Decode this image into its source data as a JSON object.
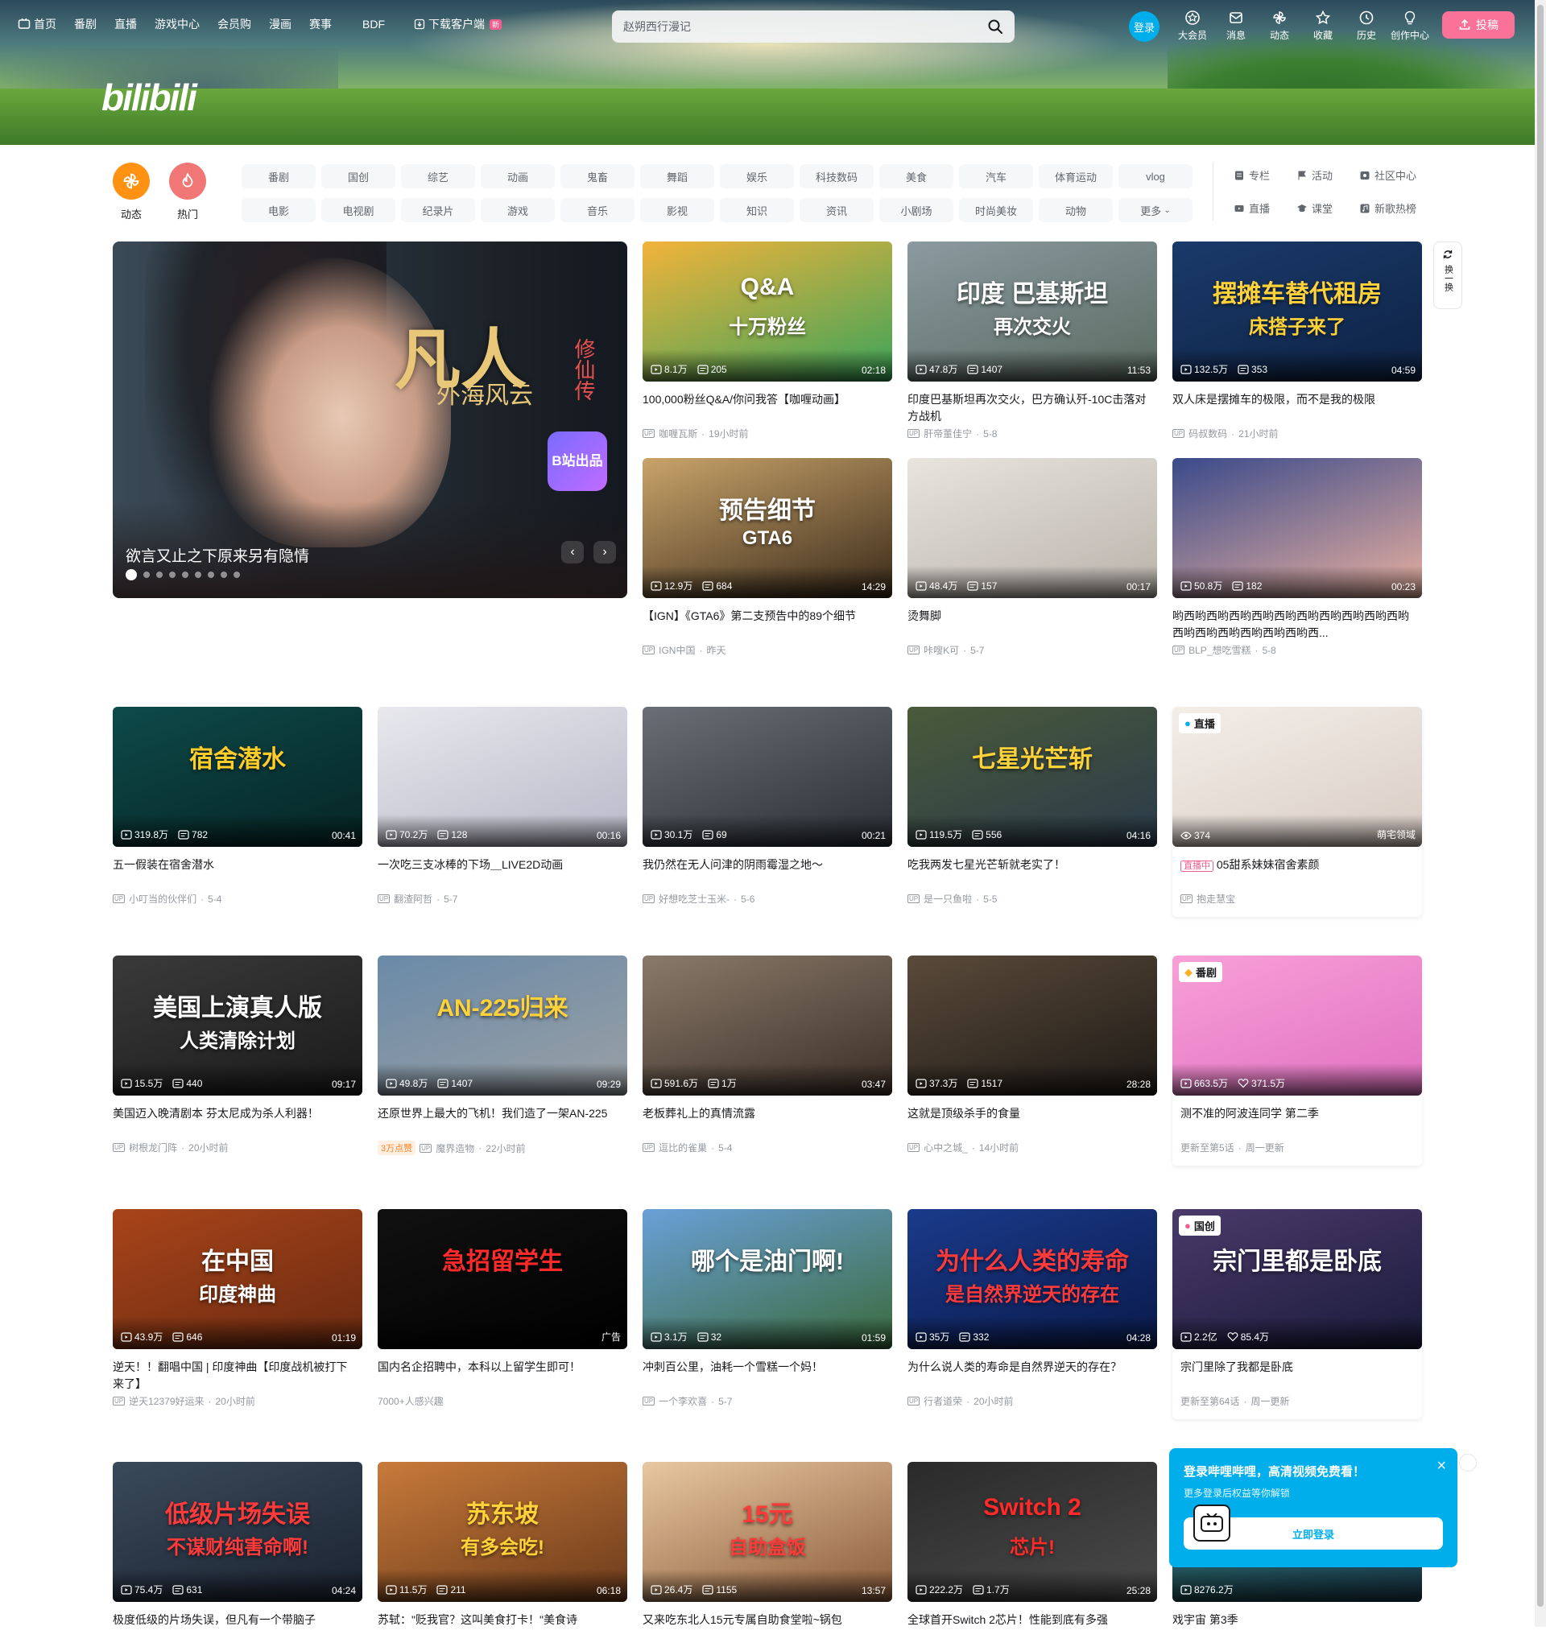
{
  "header": {
    "nav": [
      {
        "label": "首页",
        "icon": "tv-icon"
      },
      {
        "label": "番剧"
      },
      {
        "label": "直播"
      },
      {
        "label": "游戏中心"
      },
      {
        "label": "会员购"
      },
      {
        "label": "漫画"
      },
      {
        "label": "赛事"
      },
      {
        "label": "BDF"
      },
      {
        "label": "下载客户端",
        "icon": "download-icon",
        "badge": "新"
      }
    ],
    "logo": "bilibili",
    "search_placeholder": "赵朔西行漫记",
    "login_label": "登录",
    "right_nav": [
      "大会员",
      "消息",
      "动态",
      "收藏",
      "历史",
      "创作中心"
    ],
    "upload_label": "投稿"
  },
  "channels": {
    "circles": [
      {
        "label": "动态",
        "color": "#ff9212"
      },
      {
        "label": "热门",
        "color": "#f07775"
      }
    ],
    "tags": [
      "番剧",
      "国创",
      "综艺",
      "动画",
      "鬼畜",
      "舞蹈",
      "娱乐",
      "科技数码",
      "美食",
      "汽车",
      "体育运动",
      "vlog",
      "电影",
      "电视剧",
      "纪录片",
      "游戏",
      "音乐",
      "影视",
      "知识",
      "资讯",
      "小剧场",
      "时尚美妆",
      "动物",
      "更多"
    ],
    "side": [
      "专栏",
      "活动",
      "社区中心",
      "直播",
      "课堂",
      "新歌热榜"
    ]
  },
  "carousel": {
    "title": "欲言又止之下原来另有隐情",
    "art_title": "凡人",
    "art_sub": "外海风云",
    "art_side": "修仙传",
    "stamp": "B站出品",
    "dots": 9
  },
  "refresh_label": "换一换",
  "feed": [
    {
      "title": "100,000粉丝Q&A/你问我答【咖喱动画】",
      "views": "8.1万",
      "danmaku": "205",
      "duration": "02:18",
      "author": "咖喱瓦斯",
      "date": "19小时前",
      "art": "Q&A",
      "art_sub": "十万粉丝",
      "bg": [
        "#f2b33a",
        "#3aa35a"
      ],
      "art_color": "#fff"
    },
    {
      "title": "印度巴基斯坦再次交火，巴方确认歼-10C击落对方战机",
      "views": "47.8万",
      "danmaku": "1407",
      "duration": "11:53",
      "author": "肝帝董佳宁",
      "date": "5-8",
      "art": "印度 巴基斯坦",
      "art_sub": "再次交火",
      "bg": [
        "#8a9aa0",
        "#5a6a60"
      ],
      "art_color": "#fff"
    },
    {
      "title": "双人床是摆摊车的极限，而不是我的极限",
      "views": "132.5万",
      "danmaku": "353",
      "duration": "04:59",
      "author": "码叔数码",
      "date": "21小时前",
      "art": "摆摊车替代租房",
      "art_sub": "床搭子来了",
      "bg": [
        "#1a3a6a",
        "#0e2244"
      ],
      "art_color": "#ffd23a"
    },
    {
      "title": "【IGN】《GTA6》第二支预告中的89个细节",
      "views": "12.9万",
      "danmaku": "684",
      "duration": "14:29",
      "author": "IGN中国",
      "date": "昨天",
      "art": "预告细节",
      "art_sub": "GTA6",
      "bg": [
        "#c9a46a",
        "#3a2a1a"
      ],
      "art_color": "#fff"
    },
    {
      "title": "烫舞脚",
      "views": "48.4万",
      "danmaku": "157",
      "duration": "00:17",
      "author": "咔嗖K可",
      "date": "5-7",
      "art": "",
      "art_sub": "",
      "bg": [
        "#e8e4de",
        "#b8b2aa"
      ],
      "art_color": "#fff"
    },
    {
      "title": "哟西哟西哟西哟西哟西哟西哟西哟西哟西哟西哟西哟西哟西哟西哟西哟西哟西...",
      "views": "50.8万",
      "danmaku": "182",
      "duration": "00:23",
      "author": "BLP_想吃雪糕",
      "date": "5-8",
      "art": "",
      "art_sub": "",
      "bg": [
        "#3a4a8a",
        "#e8b0a0"
      ],
      "art_color": "#fff"
    },
    {
      "title": "五一假装在宿舍潜水",
      "views": "319.8万",
      "danmaku": "782",
      "duration": "00:41",
      "author": "小叮当的伙伴们",
      "date": "5-4",
      "art": "宿舍潜水",
      "art_sub": "",
      "bg": [
        "#0e4a4a",
        "#062424"
      ],
      "art_color": "#ffcc2a"
    },
    {
      "title": "一次吃三支冰棒的下场＿LIVE2D动画",
      "views": "70.2万",
      "danmaku": "128",
      "duration": "00:16",
      "author": "翻渣阿哲",
      "date": "5-7",
      "art": "",
      "art_sub": "",
      "bg": [
        "#e8e8ee",
        "#b8b8c8"
      ],
      "art_color": "#fff"
    },
    {
      "title": "我仍然在无人问津的阴雨霉湿之地～",
      "views": "30.1万",
      "danmaku": "69",
      "duration": "00:21",
      "author": "好想吃芝士玉米-",
      "date": "5-6",
      "art": "",
      "art_sub": "",
      "bg": [
        "#6a6e76",
        "#2a2e34"
      ],
      "art_color": "#fff"
    },
    {
      "title": "吃我两发七星光芒斩就老实了！",
      "views": "119.5万",
      "danmaku": "556",
      "duration": "04:16",
      "author": "是一只鱼啦",
      "date": "5-5",
      "art": "七星光芒斩",
      "art_sub": "",
      "bg": [
        "#4a5a3a",
        "#2a3a4a"
      ],
      "art_color": "#ffd23a"
    },
    {
      "title": "05甜系妹妹宿舍素颜",
      "views": "374",
      "danmaku": "",
      "duration": "",
      "author": "抱走慧宝",
      "date": "",
      "art": "",
      "art_sub": "",
      "bg": [
        "#f4eee8",
        "#d8ccc4"
      ],
      "art_color": "#fff",
      "corner": "直播",
      "live_tag": "直播中",
      "area": "萌宅领域"
    },
    {
      "title": "美国迈入晚清剧本 芬太尼成为杀人利器！",
      "views": "15.5万",
      "danmaku": "440",
      "duration": "09:17",
      "author": "树根龙门阵",
      "date": "20小时前",
      "art": "美国上演真人版",
      "art_sub": "人类清除计划",
      "bg": [
        "#3a3a3a",
        "#1a1a1a"
      ],
      "art_color": "#fff"
    },
    {
      "title": "还原世界上最大的飞机！我们造了一架AN-225",
      "views": "49.8万",
      "danmaku": "1407",
      "duration": "09:29",
      "author": "魔界造物",
      "date": "22小时前",
      "art": "AN-225归来",
      "art_sub": "",
      "bg": [
        "#6a8aa8",
        "#9aa0a4"
      ],
      "art_color": "#ffd23a",
      "hot": "3万点赞"
    },
    {
      "title": "老板葬礼上的真情流露",
      "views": "591.6万",
      "danmaku": "1万",
      "duration": "03:47",
      "author": "逗比的雀巢",
      "date": "5-4",
      "art": "",
      "art_sub": "",
      "bg": [
        "#8a7a6a",
        "#3a2e26"
      ],
      "art_color": "#fff"
    },
    {
      "title": "这就是顶级杀手的食量",
      "views": "37.3万",
      "danmaku": "1517",
      "duration": "28:28",
      "author": "心中之城_",
      "date": "14小时前",
      "art": "",
      "art_sub": "",
      "bg": [
        "#5a4a3a",
        "#1e1a16"
      ],
      "art_color": "#fff"
    },
    {
      "title": "测不准的阿波连同学 第二季",
      "views": "663.5万",
      "danmaku": "371.5万",
      "duration": "",
      "author": "",
      "date": "",
      "art": "",
      "art_sub": "",
      "bg": [
        "#f8a0d8",
        "#e070c0"
      ],
      "art_color": "#fff",
      "corner": "番剧",
      "update": "更新至第5话",
      "update2": "周一更新"
    },
    {
      "title": "逆天！！翻唱中国 | 印度神曲【印度战机被打下来了】",
      "views": "43.9万",
      "danmaku": "646",
      "duration": "01:19",
      "author": "逆天12379好运来",
      "date": "20小时前",
      "art": "在中国",
      "art_sub": "印度神曲",
      "bg": [
        "#a8441a",
        "#6a2a10"
      ],
      "art_color": "#fff"
    },
    {
      "title": "国内名企招聘中，本科以上留学生即可！",
      "views": "",
      "danmaku": "",
      "duration": "广告",
      "author": "",
      "date": "",
      "art": "急招留学生",
      "art_sub": "",
      "bg": [
        "#111111",
        "#000000"
      ],
      "art_color": "#ff2a2a",
      "ad_note": "7000+人感兴趣"
    },
    {
      "title": "冲刺百公里，油耗一个雪糕一个妈！",
      "views": "3.1万",
      "danmaku": "32",
      "duration": "01:59",
      "author": "一个李欢喜",
      "date": "5-7",
      "art": "哪个是油门啊!",
      "art_sub": "",
      "bg": [
        "#6aa0d8",
        "#3a6a3a"
      ],
      "art_color": "#fff"
    },
    {
      "title": "为什么说人类的寿命是自然界逆天的存在？",
      "views": "35万",
      "danmaku": "332",
      "duration": "04:28",
      "author": "行者道荣",
      "date": "20小时前",
      "art": "为什么人类的寿命",
      "art_sub": "是自然界逆天的存在",
      "bg": [
        "#1a3a8a",
        "#0a1a4a"
      ],
      "art_color": "#ff3a3a"
    },
    {
      "title": "宗门里除了我都是卧底",
      "views": "2.2亿",
      "danmaku": "85.4万",
      "duration": "",
      "author": "",
      "date": "",
      "art": "宗门里都是卧底",
      "art_sub": "",
      "bg": [
        "#4a3a6a",
        "#1a1a3a"
      ],
      "art_color": "#fff",
      "corner": "国创",
      "update": "更新至第64话",
      "update2": "周一更新"
    },
    {
      "title": "极度低级的片场失误，但凡有一个带脑子",
      "views": "75.4万",
      "danmaku": "631",
      "duration": "04:24",
      "author": "",
      "date": "",
      "art": "低级片场失误",
      "art_sub": "不谋财纯害命啊!",
      "bg": [
        "#3a4a5a",
        "#1a2230"
      ],
      "art_color": "#ff3a3a"
    },
    {
      "title": "苏轼：\"贬我官？这叫美食打卡！\"美食诗",
      "views": "11.5万",
      "danmaku": "211",
      "duration": "06:18",
      "author": "",
      "date": "",
      "art": "苏东坡",
      "art_sub": "有多会吃!",
      "bg": [
        "#c87a3a",
        "#6a3a1a"
      ],
      "art_color": "#ffd23a"
    },
    {
      "title": "又来吃东北人15元专属自助食堂啦~锅包",
      "views": "26.4万",
      "danmaku": "1155",
      "duration": "13:57",
      "author": "",
      "date": "",
      "art": "15元",
      "art_sub": "自助盒饭",
      "bg": [
        "#e8c8a0",
        "#8a5a3a"
      ],
      "art_color": "#ff3a3a"
    },
    {
      "title": "全球首开Switch 2芯片！性能到底有多强",
      "views": "222.2万",
      "danmaku": "1.7万",
      "duration": "25:28",
      "author": "",
      "date": "",
      "art": "Switch 2",
      "art_sub": "芯片!",
      "bg": [
        "#2a2a2a",
        "#4a4a4a"
      ],
      "art_color": "#ff2a2a"
    },
    {
      "title": "戏宇宙 第3季",
      "views": "8276.2万",
      "danmaku": "",
      "duration": "",
      "author": "",
      "date": "",
      "art": "",
      "art_sub": "",
      "bg": [
        "#2a6a6a",
        "#1a3a4a"
      ],
      "art_color": "#fff"
    }
  ],
  "popup": {
    "title": "登录哔哩哔哩，高清视频免费看！",
    "subtitle": "更多登录后权益等你解锁",
    "button": "立即登录"
  }
}
